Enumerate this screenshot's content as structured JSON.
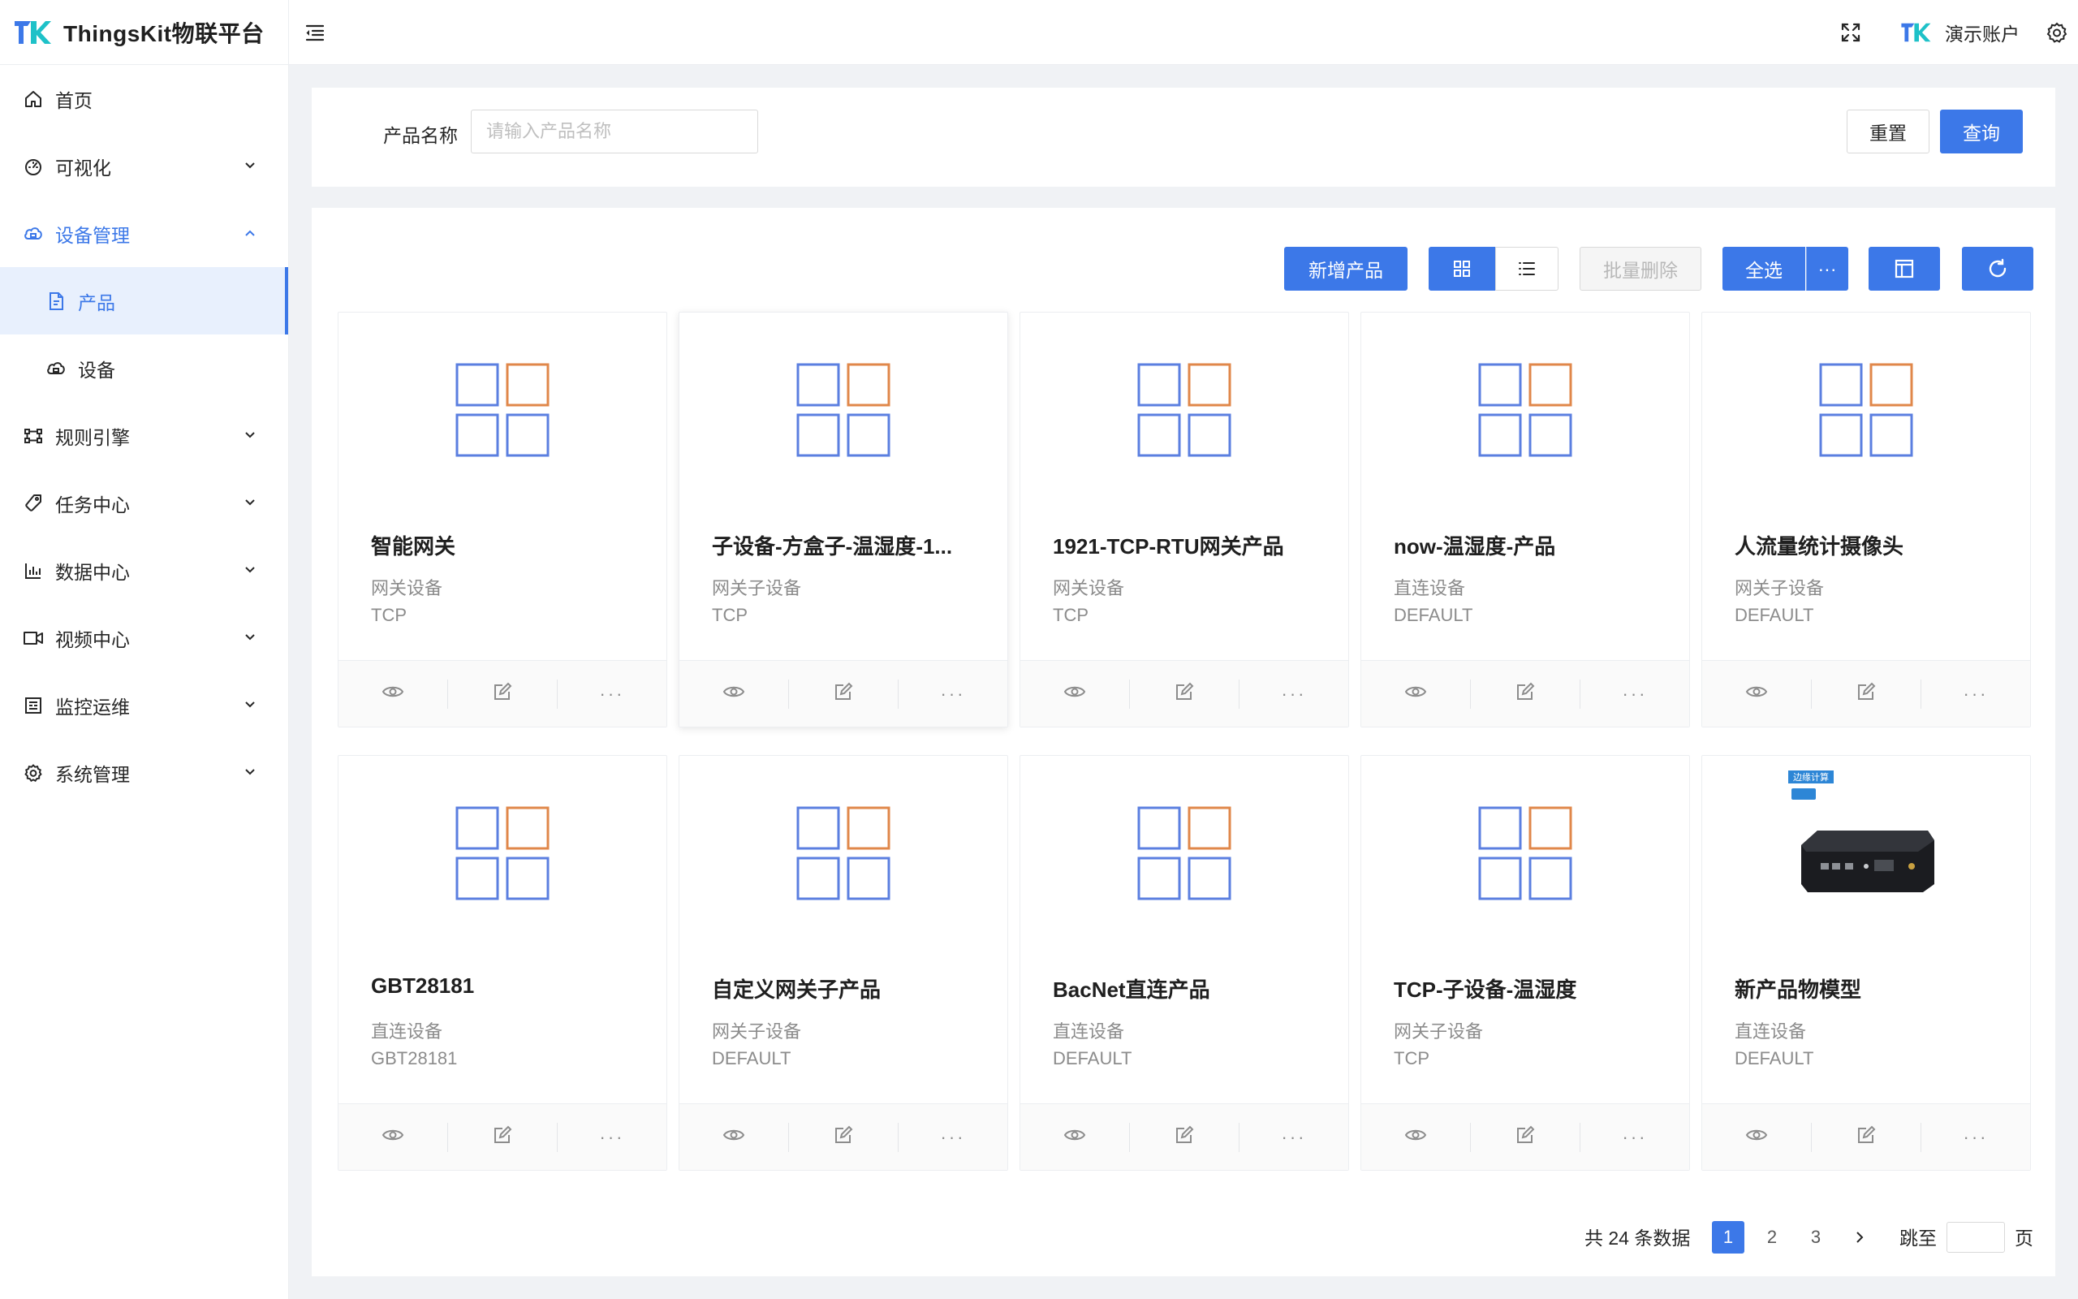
{
  "app": {
    "title": "ThingsKit物联平台"
  },
  "header": {
    "account_name": "演示账户"
  },
  "sidebar": {
    "items": [
      {
        "label": "首页",
        "icon": "home-icon"
      },
      {
        "label": "可视化",
        "icon": "dashboard-icon"
      },
      {
        "label": "设备管理",
        "icon": "cloud-device-icon",
        "expanded": true,
        "children": [
          {
            "label": "产品",
            "icon": "document-icon",
            "active": true
          },
          {
            "label": "设备",
            "icon": "cloud-icon"
          }
        ]
      },
      {
        "label": "规则引擎",
        "icon": "rule-icon"
      },
      {
        "label": "任务中心",
        "icon": "task-icon"
      },
      {
        "label": "数据中心",
        "icon": "chart-bar-icon"
      },
      {
        "label": "视频中心",
        "icon": "video-icon"
      },
      {
        "label": "监控运维",
        "icon": "monitor-icon"
      },
      {
        "label": "系统管理",
        "icon": "gear-icon"
      }
    ]
  },
  "search": {
    "label": "产品名称",
    "placeholder": "请输入产品名称",
    "reset_label": "重置",
    "query_label": "查询"
  },
  "toolbar": {
    "add_label": "新增产品",
    "batch_delete_label": "批量删除",
    "select_all_label": "全选",
    "more_label": "···"
  },
  "products": [
    {
      "name": "智能网关",
      "type": "网关设备",
      "protocol": "TCP",
      "image": "default"
    },
    {
      "name": "子设备-方盒子-温湿度-1...",
      "type": "网关子设备",
      "protocol": "TCP",
      "image": "default"
    },
    {
      "name": "1921-TCP-RTU网关产品",
      "type": "网关设备",
      "protocol": "TCP",
      "image": "default"
    },
    {
      "name": "now-温湿度-产品",
      "type": "直连设备",
      "protocol": "DEFAULT",
      "image": "default"
    },
    {
      "name": "人流量统计摄像头",
      "type": "网关子设备",
      "protocol": "DEFAULT",
      "image": "default"
    },
    {
      "name": "GBT28181",
      "type": "直连设备",
      "protocol": "GBT28181",
      "image": "default"
    },
    {
      "name": "自定义网关子产品",
      "type": "网关子设备",
      "protocol": "DEFAULT",
      "image": "default"
    },
    {
      "name": "BacNet直连产品",
      "type": "直连设备",
      "protocol": "DEFAULT",
      "image": "default"
    },
    {
      "name": "TCP-子设备-温湿度",
      "type": "网关子设备",
      "protocol": "TCP",
      "image": "default"
    },
    {
      "name": "新产品物模型",
      "type": "直连设备",
      "protocol": "DEFAULT",
      "image": "device-photo",
      "image_badge": "边缘计算"
    }
  ],
  "pagination": {
    "total_text": "共 24 条数据",
    "pages": [
      "1",
      "2",
      "3"
    ],
    "current": "1",
    "jump_prefix": "跳至",
    "jump_suffix": "页"
  },
  "colors": {
    "primary": "#3c78e8",
    "placeholder_blue": "#5b7fe0",
    "placeholder_orange": "#e0874a"
  }
}
